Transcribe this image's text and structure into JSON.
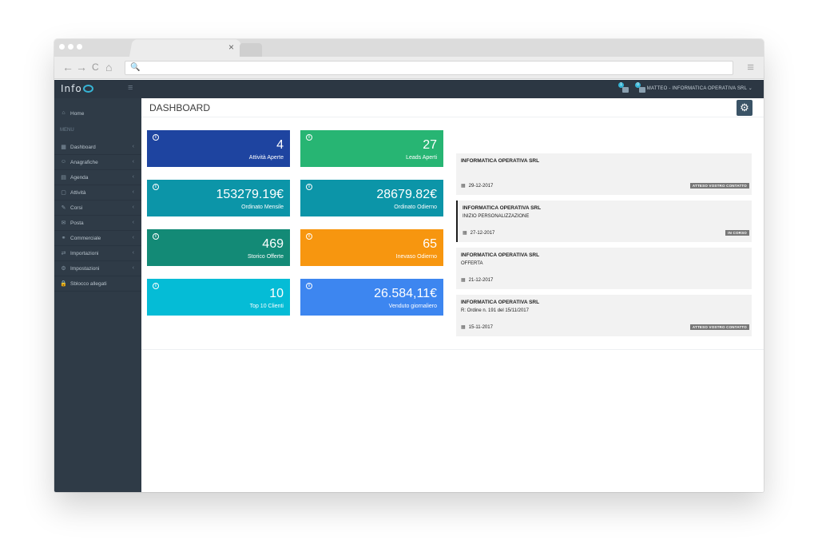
{
  "browser": {
    "tab_close": "×",
    "back": "←",
    "forward": "→",
    "reload": "C",
    "home": "⌂",
    "url_search_icon": "🔍",
    "menu_icon": "≡"
  },
  "app": {
    "logo_text": "Info",
    "toggle_icon": "≡",
    "notifications": [
      {
        "badge": "1",
        "color": "#37b5d6"
      },
      {
        "badge": "0",
        "color": "#37b5d6"
      }
    ],
    "user_label": "MATTEO - INFORMATICA OPERATIVA SRL ⌄"
  },
  "sidebar": {
    "home": {
      "label": "Home",
      "icon": "⌂"
    },
    "menu_label": "MENU",
    "items": [
      {
        "label": "Dashboard",
        "icon": "▦",
        "chevron": "‹"
      },
      {
        "label": "Anagrafiche",
        "icon": "☺",
        "chevron": "‹"
      },
      {
        "label": "Agenda",
        "icon": "▤",
        "chevron": "‹"
      },
      {
        "label": "Attività",
        "icon": "▢",
        "chevron": "‹"
      },
      {
        "label": "Corsi",
        "icon": "✎",
        "chevron": "‹"
      },
      {
        "label": "Posta",
        "icon": "✉",
        "chevron": "‹"
      },
      {
        "label": "Commerciale",
        "icon": "⚭",
        "chevron": "‹"
      },
      {
        "label": "Importazioni",
        "icon": "⇄",
        "chevron": "‹"
      },
      {
        "label": "Impostazioni",
        "icon": "⚙",
        "chevron": "‹"
      },
      {
        "label": "Sblocco allegati",
        "icon": "🔒",
        "chevron": ""
      }
    ]
  },
  "main": {
    "title": "DASHBOARD",
    "settings_icon": "⚙",
    "tiles": [
      {
        "value": "4",
        "label": "Attività Aperte",
        "color": "#1e44a0"
      },
      {
        "value": "27",
        "label": "Leads Aperti",
        "color": "#27b573"
      },
      {
        "value": "153279.19€",
        "label": "Ordinato Mensile",
        "color": "#0c95a8"
      },
      {
        "value": "28679.82€",
        "label": "Ordinato Odierno",
        "color": "#0c95a8"
      },
      {
        "value": "469",
        "label": "Storico Offerte",
        "color": "#138a76"
      },
      {
        "value": "65",
        "label": "Inevaso Odierno",
        "color": "#f7960f"
      },
      {
        "value": "10",
        "label": "Top 10 Clienti",
        "color": "#05bcd6"
      },
      {
        "value": "26.584,11€",
        "label": "Venduto giornaliero",
        "color": "#3d86f0"
      }
    ],
    "info_icon": "i",
    "calendar_icon": "▦",
    "activities": [
      {
        "company": "INFORMATICA OPERATIVA SRL",
        "subtitle": "",
        "date": "29-12-2017",
        "badge": "ATTESO VOSTRO CONTATTO"
      },
      {
        "company": "INFORMATICA OPERATIVA SRL",
        "subtitle": "INIZIO PERSONALIZZAZIONE",
        "date": "27-12-2017",
        "badge": "IN CORSO"
      },
      {
        "company": "INFORMATICA OPERATIVA SRL",
        "subtitle": "OFFERTA",
        "date": "21-12-2017",
        "badge": ""
      },
      {
        "company": "INFORMATICA OPERATIVA SRL",
        "subtitle": "R: Ordine n. 191    del 15/11/2017",
        "date": "15-11-2017",
        "badge": "ATTESO VOSTRO CONTATTO"
      }
    ]
  }
}
